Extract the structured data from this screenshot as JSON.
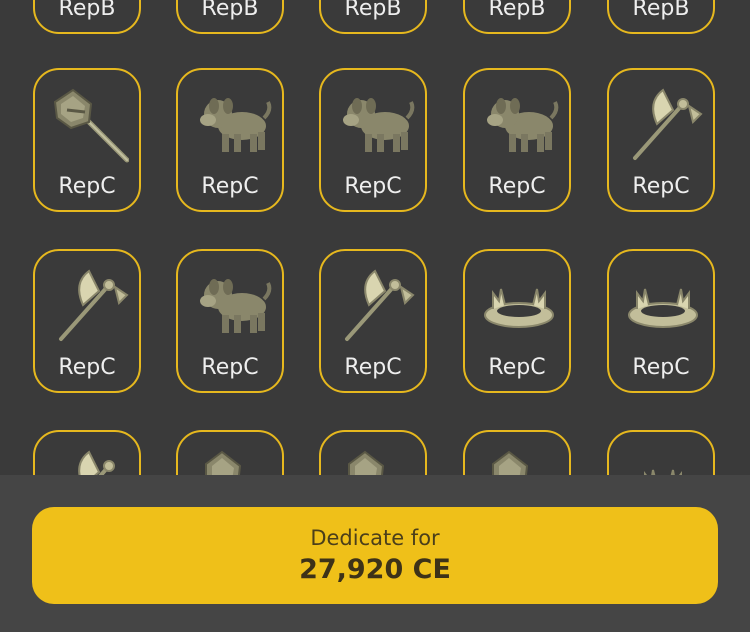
{
  "rows": [
    {
      "items": [
        {
          "label": "RepB",
          "icon": "item-icon"
        },
        {
          "label": "RepB",
          "icon": "item-icon"
        },
        {
          "label": "RepB",
          "icon": "item-icon"
        },
        {
          "label": "RepB",
          "icon": "item-icon"
        },
        {
          "label": "RepB",
          "icon": "item-icon"
        }
      ]
    },
    {
      "items": [
        {
          "label": "RepC",
          "icon": "hammer-icon"
        },
        {
          "label": "RepC",
          "icon": "dog-icon"
        },
        {
          "label": "RepC",
          "icon": "dog-icon"
        },
        {
          "label": "RepC",
          "icon": "dog-icon"
        },
        {
          "label": "RepC",
          "icon": "axe-icon"
        }
      ]
    },
    {
      "items": [
        {
          "label": "RepC",
          "icon": "axe-icon"
        },
        {
          "label": "RepC",
          "icon": "dog-icon"
        },
        {
          "label": "RepC",
          "icon": "axe-icon"
        },
        {
          "label": "RepC",
          "icon": "crown-icon"
        },
        {
          "label": "RepC",
          "icon": "crown-icon"
        }
      ]
    },
    {
      "items": [
        {
          "label": "",
          "icon": "axe-icon"
        },
        {
          "label": "",
          "icon": "hammer-icon"
        },
        {
          "label": "",
          "icon": "hammer-icon"
        },
        {
          "label": "",
          "icon": "hammer-icon"
        },
        {
          "label": "",
          "icon": "crown-icon"
        }
      ]
    }
  ],
  "dedicate": {
    "label": "Dedicate for",
    "price": "27,920 CE"
  },
  "colors": {
    "accent": "#efc019",
    "card_border": "#e6b81e",
    "background": "#3a3a3a",
    "panel": "#454545"
  }
}
